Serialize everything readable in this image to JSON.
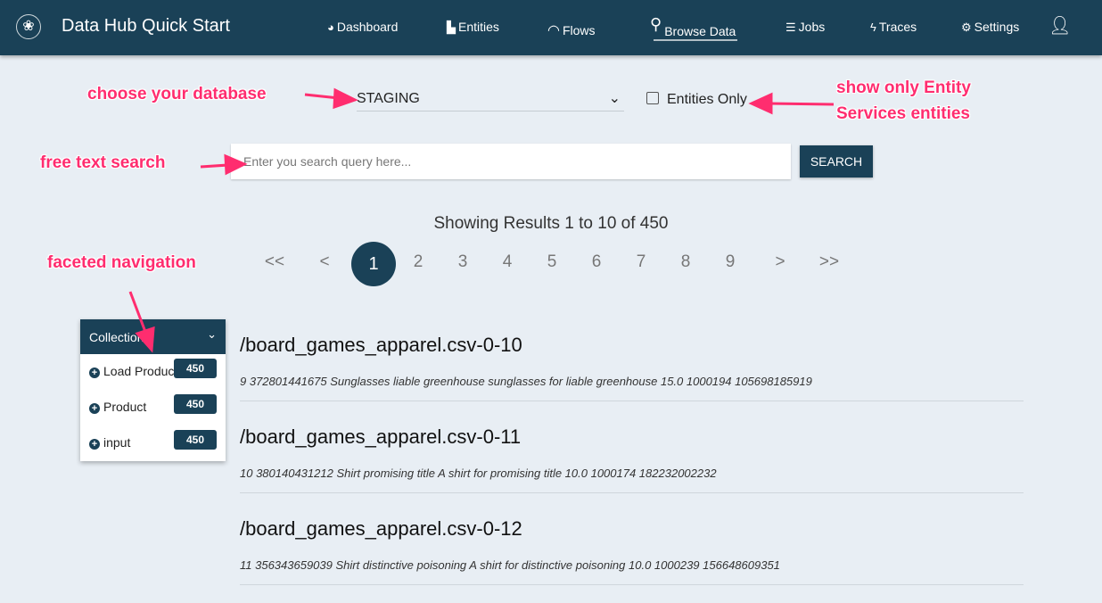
{
  "header": {
    "title": "Data Hub Quick Start",
    "nav": [
      {
        "label": "Dashboard",
        "icon": "dashboard-icon"
      },
      {
        "label": "Entities",
        "icon": "chart-icon"
      },
      {
        "label": "Flows",
        "icon": "flows-icon"
      },
      {
        "label": "Browse Data",
        "icon": "search-icon",
        "active": true
      },
      {
        "label": "Jobs",
        "icon": "jobs-icon"
      },
      {
        "label": "Traces",
        "icon": "bolt-icon"
      },
      {
        "label": "Settings",
        "icon": "gear-icon"
      }
    ],
    "user_icon": "user-icon"
  },
  "database": {
    "selected": "STAGING"
  },
  "entities_only": {
    "label": "Entities Only",
    "checked": false
  },
  "search": {
    "placeholder": "Enter you search query here...",
    "value": "",
    "button": "SEARCH"
  },
  "results_text": "Showing Results 1 to 10 of 450",
  "pagination": {
    "first": "<<",
    "prev": "<",
    "pages": [
      "1",
      "2",
      "3",
      "4",
      "5",
      "6",
      "7",
      "8",
      "9"
    ],
    "current": "1",
    "next": ">",
    "last": ">>"
  },
  "facet": {
    "title": "Collection",
    "items": [
      {
        "label": "Load Product",
        "count": "450"
      },
      {
        "label": "Product",
        "count": "450"
      },
      {
        "label": "input",
        "count": "450"
      }
    ]
  },
  "documents": [
    {
      "title": "/board_games_apparel.csv-0-10",
      "summary": "9 372801441675 Sunglasses liable greenhouse sunglasses for liable greenhouse 15.0 1000194 105698185919"
    },
    {
      "title": "/board_games_apparel.csv-0-11",
      "summary": "10 380140431212 Shirt promising title A shirt for promising title 10.0 1000174 182232002232"
    },
    {
      "title": "/board_games_apparel.csv-0-12",
      "summary": "11 356343659039 Shirt distinctive poisoning A shirt for distinctive poisoning 10.0 1000239 156648609351"
    }
  ],
  "annotations": {
    "database": "choose your database",
    "entities": "show only Entity Services entities",
    "search": "free text search",
    "facets": "faceted navigation"
  },
  "colors": {
    "primary": "#1a4157",
    "annotation": "#ff2d6f",
    "background": "#e8eef4"
  }
}
